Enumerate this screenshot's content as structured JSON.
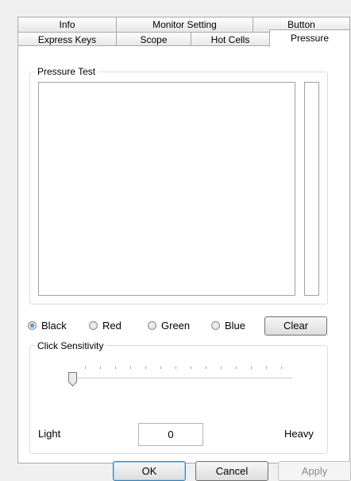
{
  "tabs_row1": [
    "Info",
    "Monitor Setting",
    "Button"
  ],
  "tabs_row2": [
    "Express Keys",
    "Scope",
    "Hot Cells",
    "Pressure"
  ],
  "pressure_test": {
    "title": "Pressure Test"
  },
  "colors": {
    "options": [
      "Black",
      "Red",
      "Green",
      "Blue"
    ],
    "selected": "Black",
    "clear_label": "Clear"
  },
  "sensitivity": {
    "title": "Click Sensitivity",
    "light_label": "Light",
    "heavy_label": "Heavy",
    "value": "0"
  },
  "footer": {
    "ok": "OK",
    "cancel": "Cancel",
    "apply": "Apply"
  },
  "palette": {
    "accent": "#3c7fb1",
    "disabled_text": "#8a8a8a"
  }
}
